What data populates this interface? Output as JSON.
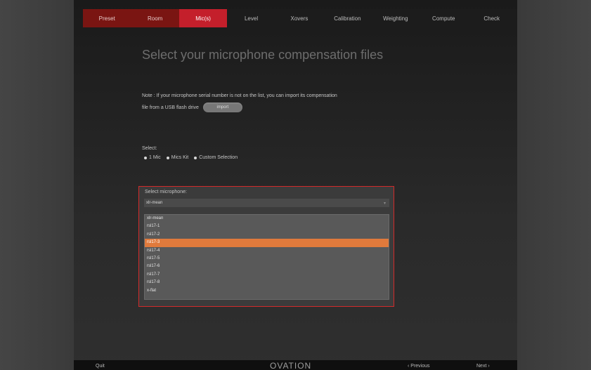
{
  "tabs": [
    {
      "label": "Preset",
      "state": "done"
    },
    {
      "label": "Room",
      "state": "done"
    },
    {
      "label": "Mic(s)",
      "state": "active"
    },
    {
      "label": "Level",
      "state": "pending"
    },
    {
      "label": "Xovers",
      "state": "pending"
    },
    {
      "label": "Calibration",
      "state": "pending"
    },
    {
      "label": "Weighting",
      "state": "pending"
    },
    {
      "label": "Compute",
      "state": "pending"
    },
    {
      "label": "Check",
      "state": "pending"
    }
  ],
  "page": {
    "heading": "Select your microphone compensation files",
    "note_line1": "Note : If your microphone serial number is not on the list, you can import its compensation",
    "note_line2": "file from a USB flash drive",
    "import_label": "import"
  },
  "select": {
    "label": "Select:",
    "options": [
      "1 Mic",
      "Mics Kit",
      "Custom Selection"
    ]
  },
  "microphone": {
    "label": "Select microphone:",
    "current_value": "xlr-mean",
    "items": [
      "xlr-mean",
      "rsl17-1",
      "rsl17-2",
      "rsl17-3",
      "rsl17-4",
      "rsl17-5",
      "rsl17-6",
      "rsl17-7",
      "rsl17-8",
      "x-flat"
    ],
    "selected_index": 3
  },
  "footer": {
    "quit": "Quit",
    "logo": "OVATION",
    "previous": "‹ Previous",
    "next": "Next ›"
  },
  "colors": {
    "accent_red": "#c41f2b",
    "done_red": "#7a1512",
    "highlight_orange": "#e07a3c",
    "box_border": "#d22a2a"
  }
}
